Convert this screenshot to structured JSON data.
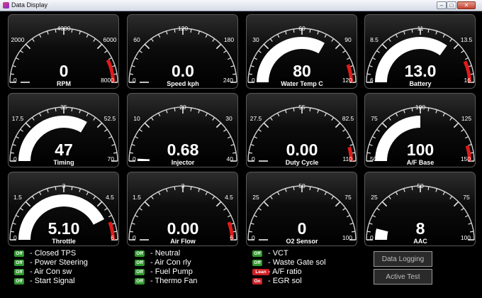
{
  "window": {
    "title": "Data Display",
    "controls": {
      "minimize": "–",
      "maximize": "□",
      "close": "✕"
    }
  },
  "colors": {
    "background": "#000000",
    "needle": "#ffffff",
    "redzone": "#e01b1b",
    "status_on": "#2f9a2c",
    "status_alert": "#cf1f24"
  },
  "gauges": [
    {
      "name": "rpm",
      "label": "RPM",
      "value": "0",
      "numeric": 0,
      "min": 0,
      "max": 8000,
      "ticks": [
        "0",
        "2000",
        "4000",
        "6000",
        "8000"
      ],
      "redzone": [
        6800,
        8000
      ]
    },
    {
      "name": "speed",
      "label": "Speed kph",
      "value": "0.0",
      "numeric": 0,
      "min": 0,
      "max": 240,
      "ticks": [
        "0",
        "60",
        "120",
        "180",
        "240"
      ],
      "redzone": null
    },
    {
      "name": "water-temp",
      "label": "Water Temp C",
      "value": "80",
      "numeric": 80,
      "min": 0,
      "max": 120,
      "ticks": [
        "0",
        "30",
        "60",
        "90",
        "120"
      ],
      "redzone": [
        106,
        120
      ]
    },
    {
      "name": "battery",
      "label": "Battery",
      "value": "13.0",
      "numeric": 13.0,
      "min": 6,
      "max": 16,
      "ticks": [
        "6",
        "8.5",
        "11",
        "13.5",
        "16"
      ],
      "redzone": [
        14.6,
        16
      ]
    },
    {
      "name": "timing",
      "label": "Timing",
      "value": "47",
      "numeric": 47,
      "min": 0,
      "max": 70,
      "ticks": [
        "0",
        "17.5",
        "35",
        "52.5",
        "70"
      ],
      "redzone": null
    },
    {
      "name": "injector",
      "label": "Injector",
      "value": "0.68",
      "numeric": 0.68,
      "min": 0,
      "max": 40,
      "ticks": [
        "0",
        "10",
        "20",
        "30",
        "40"
      ],
      "redzone": null
    },
    {
      "name": "duty-cycle",
      "label": "Duty Cycle",
      "value": "0.00",
      "numeric": 0,
      "min": 0,
      "max": 110,
      "ticks": [
        "0",
        "27.5",
        "55",
        "82.5",
        "110"
      ],
      "redzone": [
        100,
        110
      ]
    },
    {
      "name": "af-base",
      "label": "A/F Base",
      "value": "100",
      "numeric": 100,
      "min": 50,
      "max": 150,
      "ticks": [
        "50",
        "75",
        "100",
        "125",
        "150"
      ],
      "redzone": [
        140,
        150
      ]
    },
    {
      "name": "throttle",
      "label": "Throttle",
      "value": "5.10",
      "numeric": 5.1,
      "min": 0,
      "max": 6,
      "ticks": [
        "0",
        "1.5",
        "3",
        "4.5",
        "6"
      ],
      "redzone": [
        5.3,
        6
      ]
    },
    {
      "name": "air-flow",
      "label": "Air Flow",
      "value": "0.00",
      "numeric": 0,
      "min": 0,
      "max": 6,
      "ticks": [
        "0",
        "1.5",
        "3",
        "4.5",
        "6"
      ],
      "redzone": [
        5.3,
        6
      ]
    },
    {
      "name": "o2-sensor",
      "label": "O2 Sensor",
      "value": "0",
      "numeric": 0,
      "min": 0,
      "max": 100,
      "ticks": [
        "0",
        "25",
        "50",
        "75",
        "100"
      ],
      "redzone": null
    },
    {
      "name": "aac",
      "label": "AAC",
      "value": "8",
      "numeric": 8,
      "min": 0,
      "max": 100,
      "ticks": [
        "0",
        "25",
        "50",
        "75",
        "100"
      ],
      "redzone": null
    }
  ],
  "status": {
    "col1": [
      {
        "badge": "Off",
        "label": "- Closed TPS",
        "state": "green"
      },
      {
        "badge": "Off",
        "label": "- Power Steering",
        "state": "green"
      },
      {
        "badge": "Off",
        "label": "- Air Con sw",
        "state": "green"
      },
      {
        "badge": "Off",
        "label": "- Start Signal",
        "state": "green"
      }
    ],
    "col2": [
      {
        "badge": "Off",
        "label": "- Neutral",
        "state": "green"
      },
      {
        "badge": "Off",
        "label": "- Air Con rly",
        "state": "green"
      },
      {
        "badge": "Off",
        "label": "- Fuel Pump",
        "state": "green"
      },
      {
        "badge": "Off",
        "label": "- Thermo Fan",
        "state": "green"
      }
    ],
    "col3": [
      {
        "badge": "Off",
        "label": "- VCT",
        "state": "green"
      },
      {
        "badge": "Off",
        "label": "- Waste Gate sol",
        "state": "green"
      },
      {
        "badge": "Lean",
        "label": "- A/F ratio",
        "state": "red"
      },
      {
        "badge": "On",
        "label": "- EGR sol",
        "state": "red"
      }
    ]
  },
  "buttons": {
    "data_logging": "Data Logging",
    "active_test": "Active Test"
  }
}
